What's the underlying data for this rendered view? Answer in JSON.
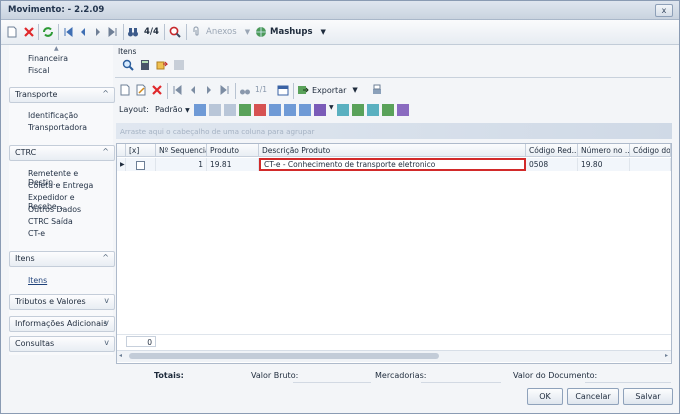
{
  "window": {
    "title": "Movimento: - 2.2.09",
    "close_label": "x"
  },
  "toolbar": {
    "record_counter": "4/4",
    "anexos_label": "Anexos",
    "mashups_label": "Mashups"
  },
  "sidebar": {
    "partial_items": [
      "Financeira",
      "Fiscal"
    ],
    "sections": [
      {
        "label": "Transporte",
        "chevron": "^",
        "items": [
          "Identificação",
          "Transportadora"
        ]
      },
      {
        "label": "CTRC",
        "chevron": "^",
        "items": [
          "Remetente e Destin...",
          "Coleta e Entrega",
          "Expedidor e Recebe...",
          "Outros Dados",
          "CTRC Saída",
          "CT-e"
        ]
      },
      {
        "label": "Itens",
        "chevron": "^",
        "items": [
          "Itens"
        ]
      },
      {
        "label": "Tributos e Valores",
        "chevron": "v",
        "items": []
      },
      {
        "label": "Informações Adicionais",
        "chevron": "v",
        "items": []
      },
      {
        "label": "Consultas",
        "chevron": "v",
        "items": []
      }
    ]
  },
  "itens_panel": {
    "title": "Itens",
    "record_counter": "1/1",
    "exportar_label": "Exportar",
    "layout_label": "Layout:",
    "layout_value": "Padrão",
    "group_hint": "Arraste aqui o cabeçalho de uma coluna para agrupar",
    "columns": [
      "[x]",
      "Nº Sequencial",
      "Produto",
      "Descrição Produto",
      "Código Red...",
      "Número no ...",
      "Código do ..."
    ],
    "rows": [
      {
        "sequencial": "1",
        "produto": "19.81",
        "descricao": "CT-e - Conhecimento de transporte eletronico",
        "codigo_red": "0508",
        "numero_no": "19.80",
        "codigo_do": ""
      }
    ],
    "footer_count": "0"
  },
  "totals": {
    "label": "Totais:",
    "valor_bruto_label": "Valor Bruto:",
    "mercadorias_label": "Mercadorias:",
    "valor_documento_label": "Valor do Documento:"
  },
  "buttons": {
    "ok": "OK",
    "cancelar": "Cancelar",
    "salvar": "Salvar"
  }
}
